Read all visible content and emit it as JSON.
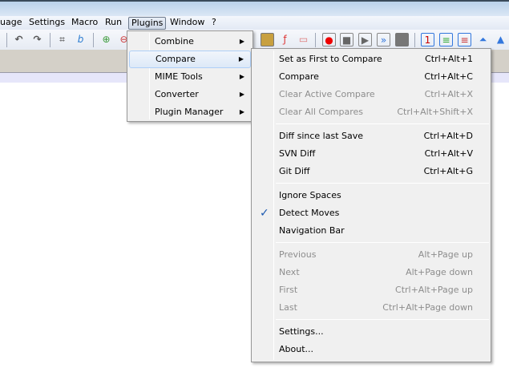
{
  "menubar": [
    "uage",
    "Settings",
    "Macro",
    "Run",
    "Plugins",
    "Window",
    "?"
  ],
  "plugins_menu": [
    {
      "label": "Combine",
      "submenu": true
    },
    {
      "label": "Compare",
      "submenu": true,
      "highlighted": true
    },
    {
      "label": "MIME Tools",
      "submenu": true
    },
    {
      "label": "Converter",
      "submenu": true
    },
    {
      "label": "Plugin Manager",
      "submenu": true
    }
  ],
  "compare_menu": {
    "groups": [
      [
        {
          "label": "Set as First to Compare",
          "shortcut": "Ctrl+Alt+1",
          "enabled": true
        },
        {
          "label": "Compare",
          "shortcut": "Ctrl+Alt+C",
          "enabled": true
        },
        {
          "label": "Clear Active Compare",
          "shortcut": "Ctrl+Alt+X",
          "enabled": false
        },
        {
          "label": "Clear All Compares",
          "shortcut": "Ctrl+Alt+Shift+X",
          "enabled": false
        }
      ],
      [
        {
          "label": "Diff since last Save",
          "shortcut": "Ctrl+Alt+D",
          "enabled": true
        },
        {
          "label": "SVN Diff",
          "shortcut": "Ctrl+Alt+V",
          "enabled": true
        },
        {
          "label": "Git Diff",
          "shortcut": "Ctrl+Alt+G",
          "enabled": true
        }
      ],
      [
        {
          "label": "Ignore Spaces",
          "shortcut": "",
          "enabled": true,
          "checked": false
        },
        {
          "label": "Detect Moves",
          "shortcut": "",
          "enabled": true,
          "checked": true
        },
        {
          "label": "Navigation Bar",
          "shortcut": "",
          "enabled": true,
          "checked": false
        }
      ],
      [
        {
          "label": "Previous",
          "shortcut": "Alt+Page up",
          "enabled": false
        },
        {
          "label": "Next",
          "shortcut": "Alt+Page down",
          "enabled": false
        },
        {
          "label": "First",
          "shortcut": "Ctrl+Alt+Page up",
          "enabled": false
        },
        {
          "label": "Last",
          "shortcut": "Ctrl+Alt+Page down",
          "enabled": false
        }
      ],
      [
        {
          "label": "Settings...",
          "shortcut": "",
          "enabled": true
        },
        {
          "label": "About...",
          "shortcut": "",
          "enabled": true
        }
      ]
    ]
  },
  "check_glyph": "✓",
  "arrow_glyph": "▶"
}
